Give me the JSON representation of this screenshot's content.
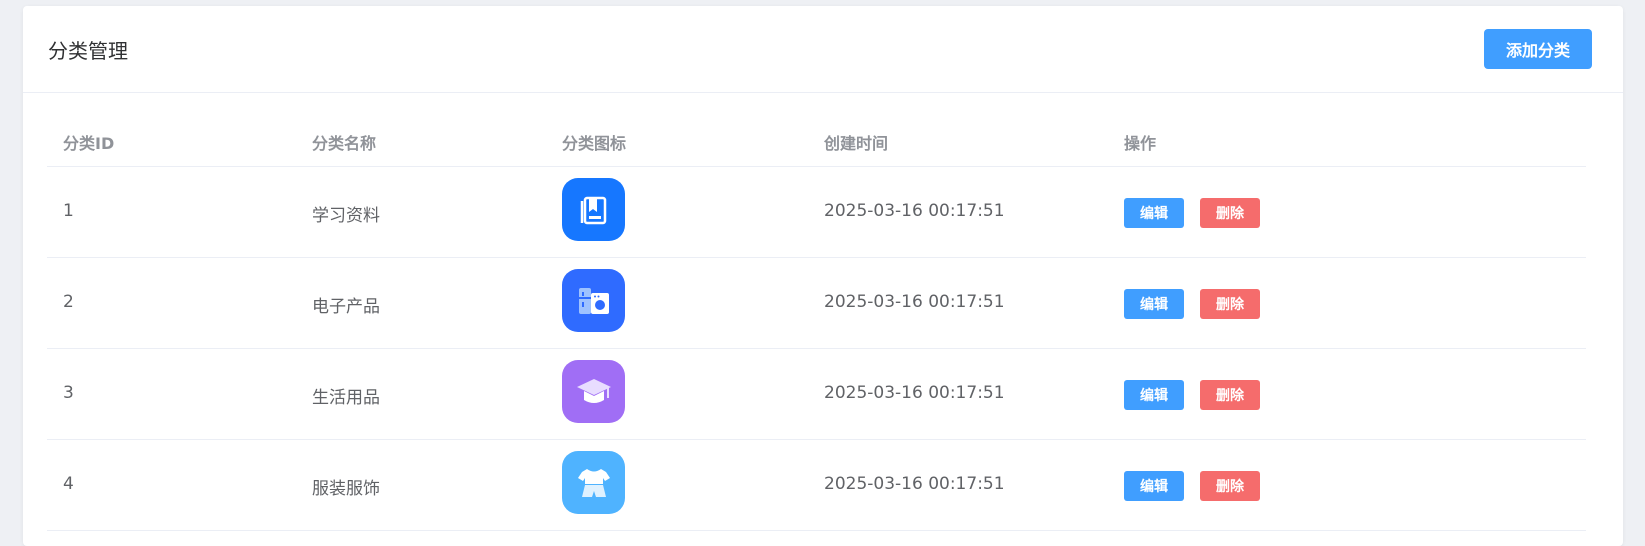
{
  "header": {
    "title": "分类管理",
    "add_label": "添加分类"
  },
  "table": {
    "columns": [
      "分类ID",
      "分类名称",
      "分类图标",
      "创建时间",
      "操作"
    ],
    "rows": [
      {
        "id": "1",
        "name": "学习资料",
        "icon": "book-icon",
        "icon_color": "#1677ff",
        "created": "2025-03-16 00:17:51",
        "edit": "编辑",
        "delete": "删除"
      },
      {
        "id": "2",
        "name": "电子产品",
        "icon": "appliance-icon",
        "icon_color": "#2f6bff",
        "created": "2025-03-16 00:17:51",
        "edit": "编辑",
        "delete": "删除"
      },
      {
        "id": "3",
        "name": "生活用品",
        "icon": "graduation-cap-icon",
        "icon_color": "#a06ef5",
        "created": "2025-03-16 00:17:51",
        "edit": "编辑",
        "delete": "删除"
      },
      {
        "id": "4",
        "name": "服装服饰",
        "icon": "clothing-icon",
        "icon_color": "#4fb3ff",
        "created": "2025-03-16 00:17:51",
        "edit": "编辑",
        "delete": "删除"
      }
    ]
  },
  "colors": {
    "primary": "#409eff",
    "danger": "#f56c6c"
  }
}
